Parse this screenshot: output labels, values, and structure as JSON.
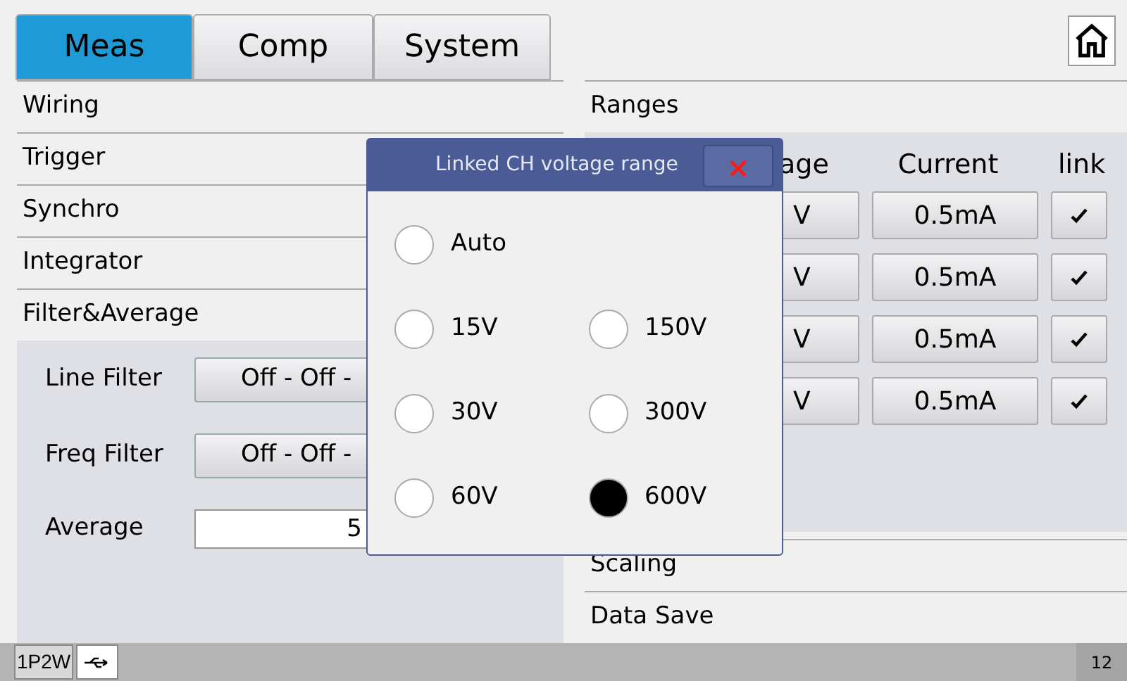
{
  "tabs": [
    {
      "label": "Meas",
      "selected": true
    },
    {
      "label": "Comp",
      "selected": false
    },
    {
      "label": "System",
      "selected": false
    }
  ],
  "left_sections": [
    {
      "label": "Wiring"
    },
    {
      "label": "Trigger"
    },
    {
      "label": "Synchro"
    },
    {
      "label": "Integrator"
    },
    {
      "label": "Filter&Average"
    }
  ],
  "filter_average": {
    "line_filter": {
      "label": "Line Filter",
      "value": "Off - Off -"
    },
    "freq_filter": {
      "label": "Freq Filter",
      "value": "Off - Off -"
    },
    "average": {
      "label": "Average",
      "value": "5"
    }
  },
  "ranges": {
    "title": "Ranges",
    "columns": [
      "age",
      "Current",
      "link"
    ],
    "rows": [
      {
        "voltage": "V",
        "current": "0.5mA",
        "link": true
      },
      {
        "voltage": "V",
        "current": "0.5mA",
        "link": true
      },
      {
        "voltage": "V",
        "current": "0.5mA",
        "link": true
      },
      {
        "voltage": "V",
        "current": "0.5mA",
        "link": true
      }
    ]
  },
  "right_sections": [
    {
      "label": "Scaling"
    },
    {
      "label": "Data Save"
    }
  ],
  "dialog": {
    "title": "Linked CH voltage range",
    "close": "×",
    "options": [
      {
        "label": "Auto",
        "selected": false
      },
      {
        "label": "15V",
        "selected": false
      },
      {
        "label": "150V",
        "selected": false
      },
      {
        "label": "30V",
        "selected": false
      },
      {
        "label": "300V",
        "selected": false
      },
      {
        "label": "60V",
        "selected": false
      },
      {
        "label": "600V",
        "selected": true
      }
    ]
  },
  "status_bar": {
    "wiring": "1P2W",
    "page": "12"
  }
}
